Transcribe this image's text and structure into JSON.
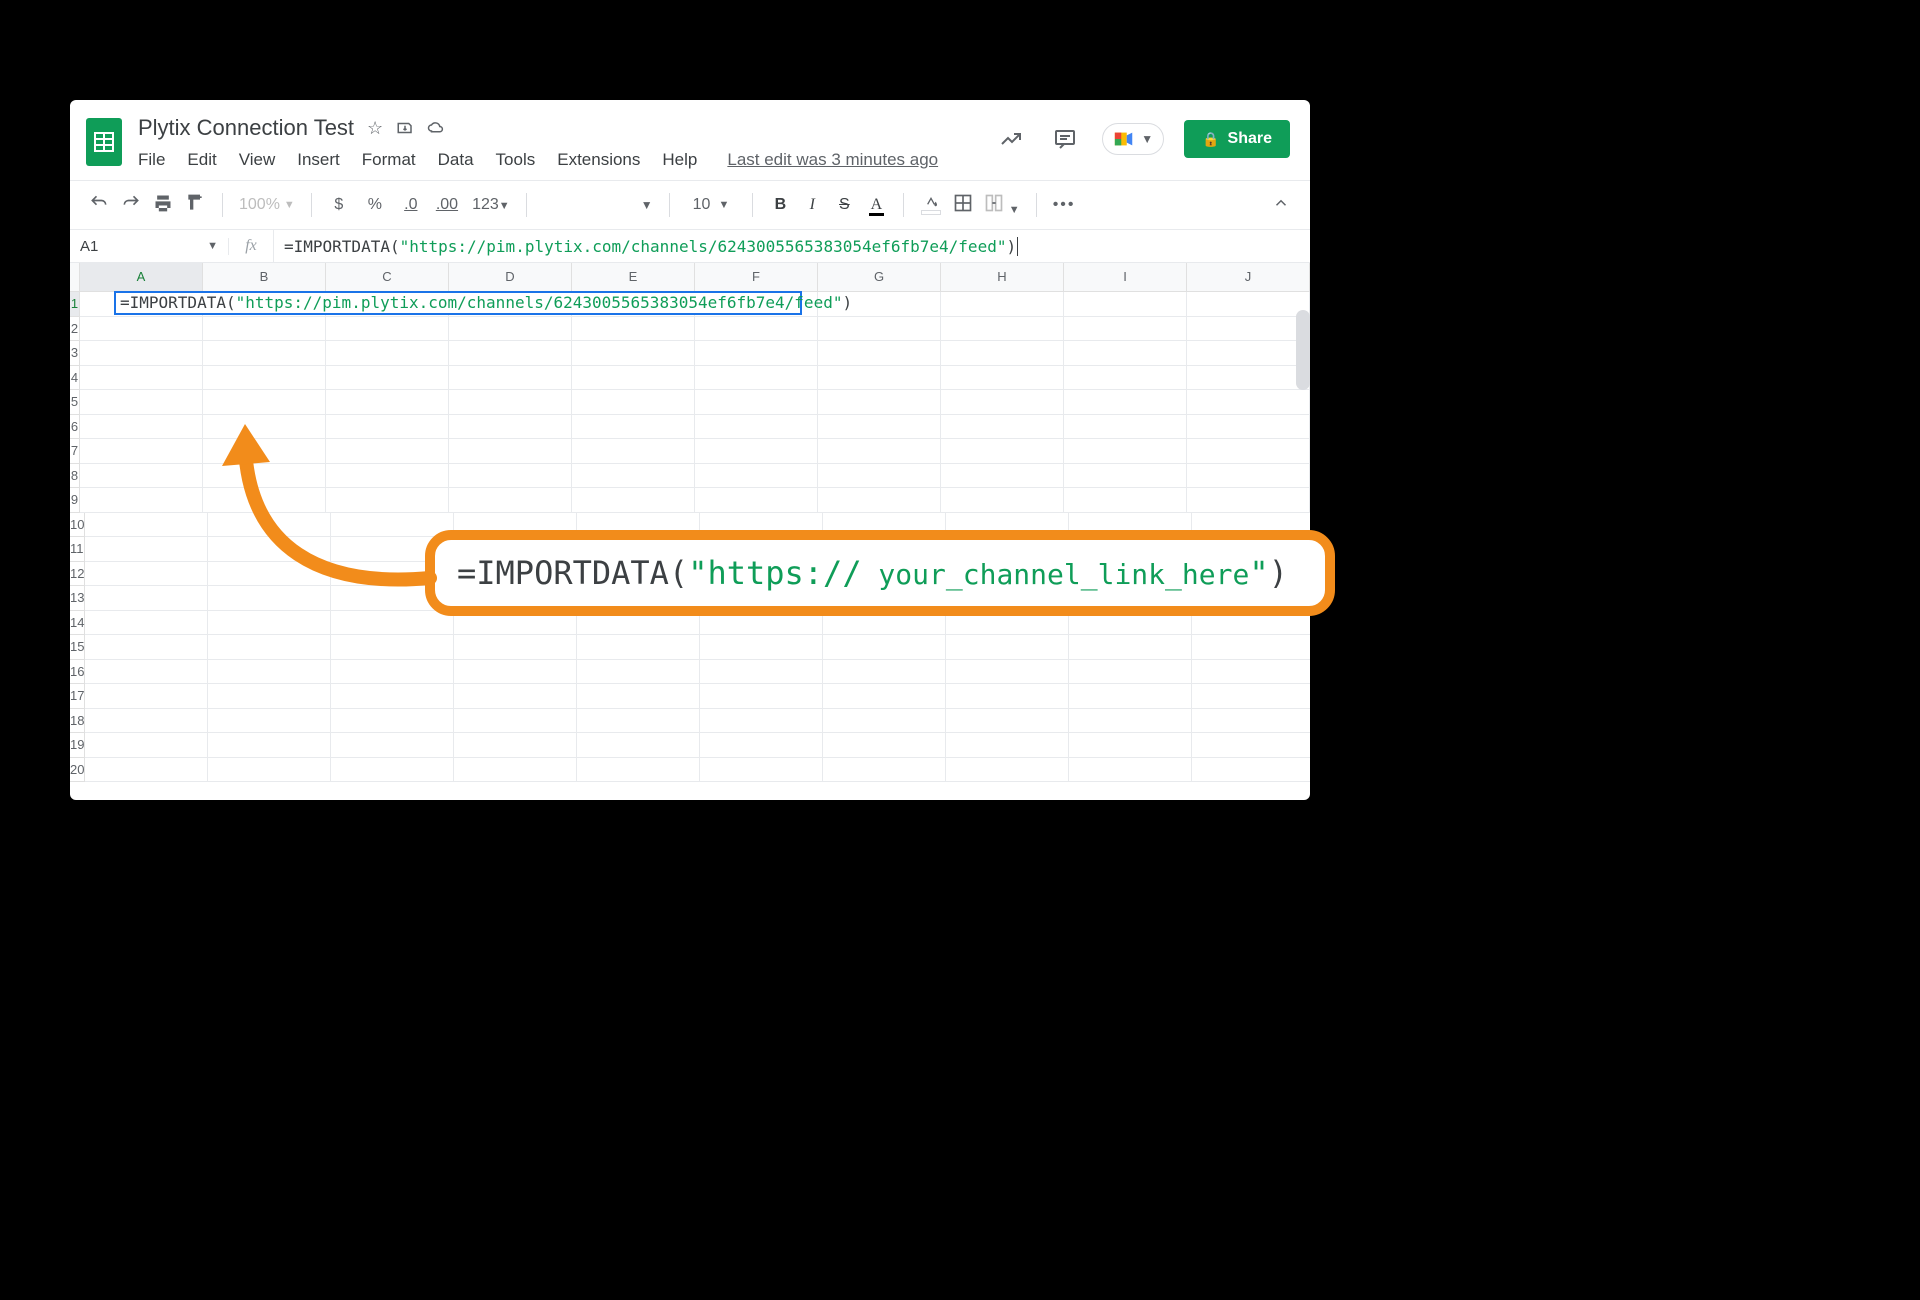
{
  "doc": {
    "title": "Plytix Connection Test",
    "last_edit": "Last edit was 3 minutes ago"
  },
  "menus": {
    "file": "File",
    "edit": "Edit",
    "view": "View",
    "insert": "Insert",
    "format": "Format",
    "data": "Data",
    "tools": "Tools",
    "extensions": "Extensions",
    "help": "Help"
  },
  "share": {
    "label": "Share"
  },
  "toolbar": {
    "zoom": "100%",
    "currency": "$",
    "percent": "%",
    "dec_dec": ".0",
    "inc_dec": ".00",
    "num_fmt": "123",
    "font_size": "10",
    "bold": "B",
    "italic": "I",
    "strike": "S",
    "text_color": "A",
    "more": "???"
  },
  "fx": {
    "cell_ref": "A1",
    "formula_prefix": "=IMPORTDATA(",
    "formula_url": "\"https://pim.plytix.com/channels/6243005565383054ef6fb7e4/feed\"",
    "formula_suffix": ")"
  },
  "grid": {
    "columns": [
      "A",
      "B",
      "C",
      "D",
      "E",
      "F",
      "G",
      "H",
      "I",
      "J"
    ],
    "rows": [
      "1",
      "2",
      "3",
      "4",
      "5",
      "6",
      "7",
      "8",
      "9",
      "10",
      "11",
      "12",
      "13",
      "14",
      "15",
      "16",
      "17",
      "18",
      "19",
      "20"
    ]
  },
  "cell_a1": {
    "prefix": "=IMPORTDATA(",
    "url": "\"https://pim.plytix.com/channels/6243005565383054ef6fb7e4/feed\"",
    "suffix": ")"
  },
  "annot": {
    "prefix": "=IMPORTDATA(",
    "quote_open": "\"https://",
    "placeholder": " your_channel_link_here",
    "quote_close": "\"",
    "suffix": ")"
  }
}
